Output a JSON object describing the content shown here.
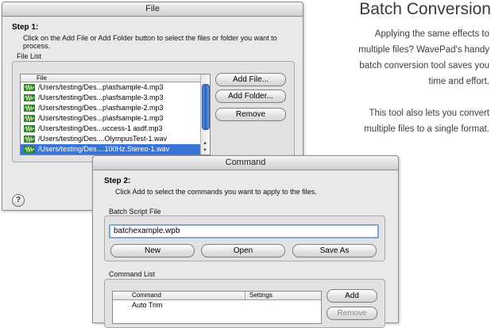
{
  "file_window": {
    "title": "File",
    "step_title": "Step 1:",
    "step_desc": "Click on the Add File or Add Folder button to select the files or folder you want to process.",
    "group_label": "File List",
    "column_header": "File",
    "files": [
      "/Users/testing/Des...p\\asfsample-4.mp3",
      "/Users/testing/Des...p\\asfsample-3.mp3",
      "/Users/testing/Des...p\\asfsample-2.mp3",
      "/Users/testing/Des...p\\asfsample-1.mp3",
      "/Users/testing/Des...uccess-1  asdf.mp3",
      "/Users/testing/Des....OlympusTest-1.wav",
      "/Users/testing/Des....100Hz.Stereo-1.wav"
    ],
    "selected_index": 6,
    "add_file_label": "Add File...",
    "add_folder_label": "Add Folder...",
    "remove_label": "Remove",
    "help_label": "?"
  },
  "command_window": {
    "title": "Command",
    "step_title": "Step 2:",
    "step_desc": "Click Add to select the commands you want to apply to the files.",
    "batch_label": "Batch Script File",
    "batch_value": "batchexample.wpb",
    "new_label": "New",
    "open_label": "Open",
    "save_as_label": "Save As",
    "command_list_label": "Command List",
    "col_command": "Command",
    "col_settings": "Settings",
    "commands": [
      "Auto Trim"
    ],
    "add_label": "Add",
    "remove_label": "Remove"
  },
  "promo": {
    "heading": "Batch Conversion",
    "para1_lines": [
      "Applying the same effects to",
      "multiple files? WavePad's handy",
      "batch conversion tool saves you",
      "time and effort."
    ],
    "para2_lines": [
      "This tool also lets you convert",
      "multiple files to a single format."
    ]
  },
  "colors": {
    "selection": "#3875d7",
    "file_icon": "#2d7f2d",
    "focus_ring": "#7fa6da"
  }
}
